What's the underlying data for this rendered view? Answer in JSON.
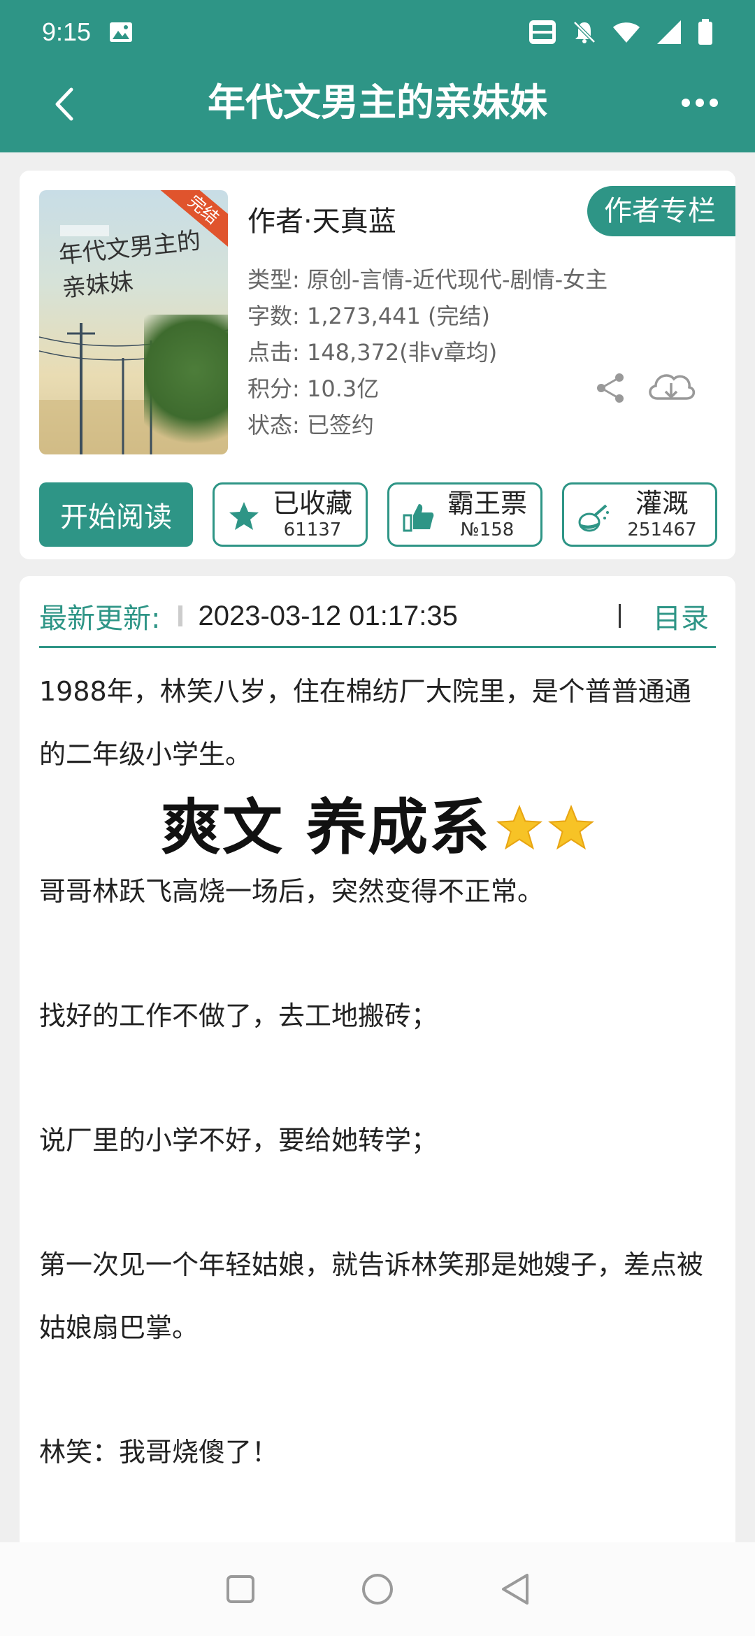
{
  "status_bar": {
    "time": "9:15"
  },
  "header": {
    "title": "年代文男主的亲妹妹"
  },
  "book": {
    "cover_title": "年代文男主的亲妹妹",
    "cover_badge": "完结",
    "author": "作者·天真蓝",
    "author_column": "作者专栏",
    "meta": [
      "类型: 原创-言情-近代现代-剧情-女主",
      "字数: 1,273,441 (完结)",
      "点击: 148,372(非v章均)",
      "积分: 10.3亿",
      "状态: 已签约"
    ]
  },
  "actions": {
    "start_reading": "开始阅读",
    "collected": {
      "label": "已收藏",
      "count": "61137"
    },
    "bawang": {
      "label": "霸王票",
      "count": "№158"
    },
    "irrigate": {
      "label": "灌溉",
      "count": "251467"
    }
  },
  "latest": {
    "label": "最新更新:",
    "time": "2023-03-12 01:17:35",
    "toc": "目录"
  },
  "summary": {
    "p1": "1988年，林笑八岁，住在棉纺厂大院里，是个普普通通的二年级小学生。",
    "tagline": "爽文 养成系",
    "p2": "哥哥林跃飞高烧一场后，突然变得不正常。",
    "p3": "找好的工作不做了，去工地搬砖；",
    "p4": "说厂里的小学不好，要给她转学；",
    "p5": "第一次见一个年轻姑娘，就告诉林笑那是她嫂子，差点被姑娘扇巴掌。",
    "p6": "林笑：我哥烧傻了！"
  },
  "colors": {
    "primary": "#2e9586",
    "badge": "#e0542d"
  }
}
